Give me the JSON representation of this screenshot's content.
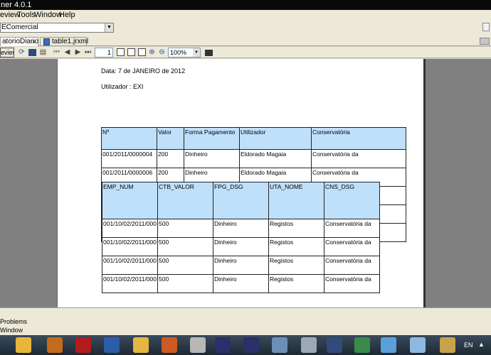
{
  "window": {
    "title": "ner 4.0.1"
  },
  "menu": [
    "eview",
    "Tools",
    "Window",
    "Help"
  ],
  "datasource": {
    "value": "EComercial"
  },
  "tabs": [
    {
      "label": "atorioDiario"
    },
    {
      "label": "table1.jrxml"
    }
  ],
  "toolbar": {
    "preview_label": "eview",
    "page_number": "1",
    "zoom": "100%"
  },
  "report": {
    "date_line": "Data: 7 de JANEIRO de 2012",
    "user_line": "Utilizador : EXI",
    "table1": {
      "headers": [
        "Nº",
        "Valor",
        "Forma Pagamento",
        "Utilizador",
        "Conservatória"
      ],
      "rows": [
        [
          "001/2011/0000004",
          "200",
          "Dinheiro",
          "Eldorado Magaia",
          "Conservatória da"
        ],
        [
          "001/2011/0000006",
          "200",
          "Dinheiro",
          "Eldorado Magaia",
          "Conservatória da"
        ]
      ]
    },
    "table2": {
      "headers": [
        "EMP_NUM",
        "CTB_VALOR",
        "FPG_DSG",
        "UTA_NOME",
        "CNS_DSG"
      ],
      "rows": [
        [
          "001/10/02/2011/000",
          "500",
          "Dinheiro",
          "Registos",
          "Conservatória da"
        ],
        [
          "001/10/02/2011/000",
          "500",
          "Dinheiro",
          "Registos",
          "Conservatória da"
        ],
        [
          "001/10/02/2011/000",
          "500",
          "Dinheiro",
          "Registos",
          "Conservatória da"
        ],
        [
          "001/10/02/2011/000",
          "500",
          "Dinheiro",
          "Registos",
          "Conservatória da"
        ]
      ]
    }
  },
  "bottom_panel": {
    "label": "Problems Window"
  },
  "taskbar": {
    "language": "EN"
  },
  "colors": {
    "header_fill": "#bfe0fb",
    "canvas": "#808080"
  }
}
